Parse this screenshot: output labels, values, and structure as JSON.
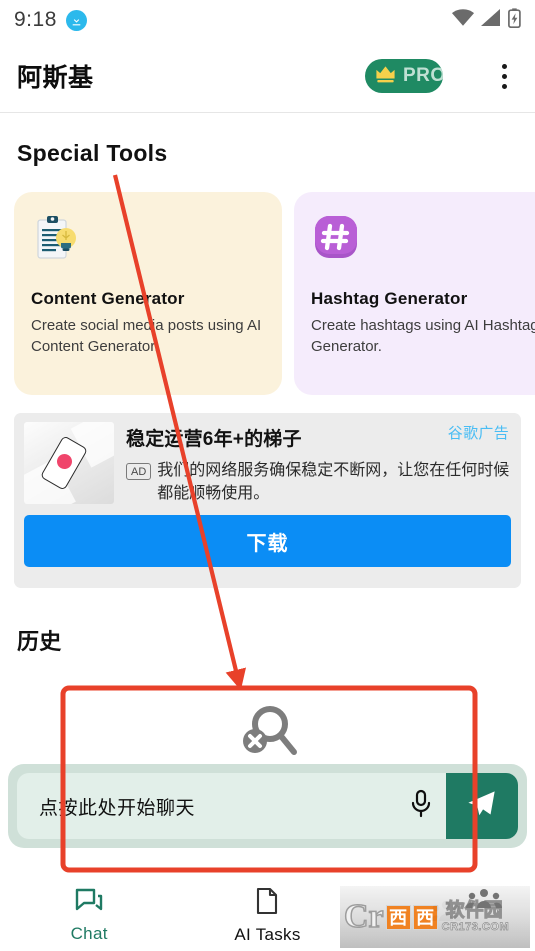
{
  "status_bar": {
    "time": "9:18",
    "icons": [
      "download-icon",
      "wifi-icon",
      "cellular-signal-icon",
      "battery-charging-icon"
    ]
  },
  "app_bar": {
    "title": "阿斯基",
    "pro_badge_label": "PRO",
    "pro_badge_color": "#1f8a63",
    "crown_color": "#f5d14b",
    "overflow_icon": "kebab-menu-icon"
  },
  "sections": {
    "special_tools_title": "Special Tools",
    "history_title": "历史"
  },
  "tools": [
    {
      "title": "Content Generator",
      "description": "Create social media posts using AI Content Generator.",
      "background": "#fbf2dc",
      "icon": "clipboard-lightbulb-icon"
    },
    {
      "title": "Hashtag Generator",
      "description": "Create hashtags using AI Hashtag Generator.",
      "background": "#f5ecfc",
      "icon": "hashtag-icon"
    }
  ],
  "ad": {
    "provider_label": "谷歌广告",
    "provider_color": "#49bdf4",
    "headline": "稳定运营6年+的梯子",
    "ad_tag": "AD",
    "description": "我们的网络服务确保稳定不断网，让您在任何时候都能顺畅使用。",
    "cta_label": "下载",
    "cta_color": "#0b8df5",
    "thumbnail": "phone-on-white-blocks-image"
  },
  "history": {
    "empty_icon": "search-no-results-icon",
    "empty_icon_color": "#808080"
  },
  "chat_bar": {
    "placeholder": "点按此处开始聊天",
    "mic_icon": "microphone-icon",
    "send_icon": "send-paper-plane-icon",
    "send_button_color": "#1f7a63",
    "bar_color": "#cfe0d8",
    "field_color": "#e2efe9"
  },
  "bottom_nav": [
    {
      "label": "Chat",
      "icon": "chat-bubbles-icon",
      "active": true,
      "color": "#1f7a63"
    },
    {
      "label": "AI Tasks",
      "icon": "document-page-icon",
      "active": false,
      "color": "#111111"
    },
    {
      "label": "",
      "icon": "people-group-icon",
      "active": false,
      "color": "#111111"
    }
  ],
  "watermark": {
    "brand_mark": "Cr",
    "brand_cn": "西西",
    "brand_name": "软件园",
    "url": "CR173.COM"
  },
  "annotations": {
    "color": "#e8412a",
    "arrow_label": "arrow-pointing-to-chat-area",
    "box_label": "highlight-box-around-chat-input"
  }
}
